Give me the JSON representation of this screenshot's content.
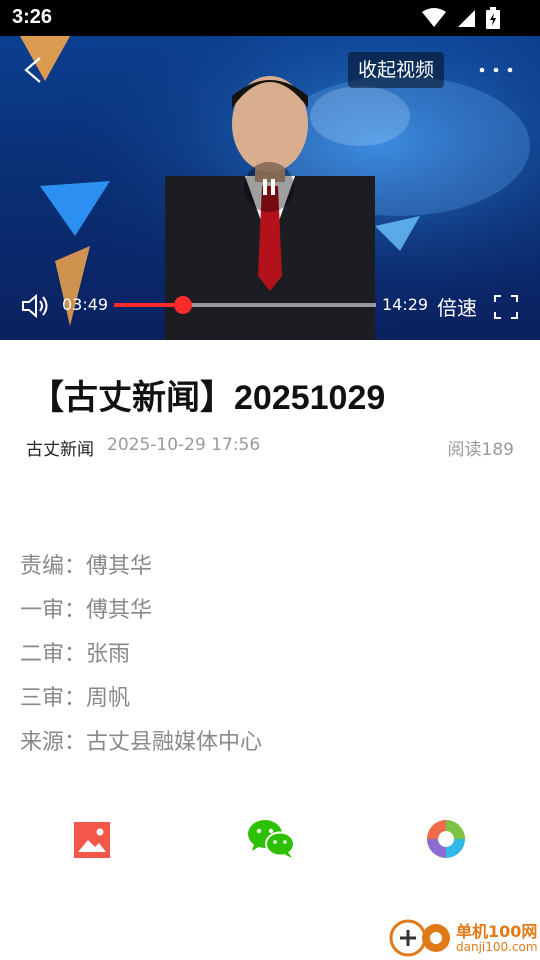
{
  "status_bar": {
    "time": "3:26",
    "icons": [
      "wifi-icon",
      "signal-icon",
      "battery-icon"
    ]
  },
  "player": {
    "collapse_label": "收起视频",
    "current_time": "03:49",
    "total_time": "14:29",
    "speed_label": "倍速",
    "progress_fraction": 0.263,
    "icons": [
      "back-arrow-icon",
      "more-dots-icon",
      "pause-icon",
      "volume-icon",
      "fullscreen-icon"
    ]
  },
  "article": {
    "title": "【古丈新闻】20251029",
    "source": "古丈新闻",
    "date": "2025-10-29 17:56",
    "reads": "阅读189",
    "credits": [
      "责编：傅其华",
      "一审：傅其华",
      "二审：张雨",
      "三审：周帆",
      "来源：古丈县融媒体中心"
    ]
  },
  "share": {
    "items": [
      {
        "icon": "image-share-icon",
        "color": "#f2574a"
      },
      {
        "icon": "wechat-icon",
        "color": "#2dc100"
      },
      {
        "icon": "moments-icon",
        "color": "#7dc242"
      }
    ]
  },
  "watermark": {
    "line1": "单机100网",
    "line2": "danji100.com"
  },
  "colors": {
    "accent_red": "#ff2b2b",
    "watermark_orange": "#e07a18"
  }
}
